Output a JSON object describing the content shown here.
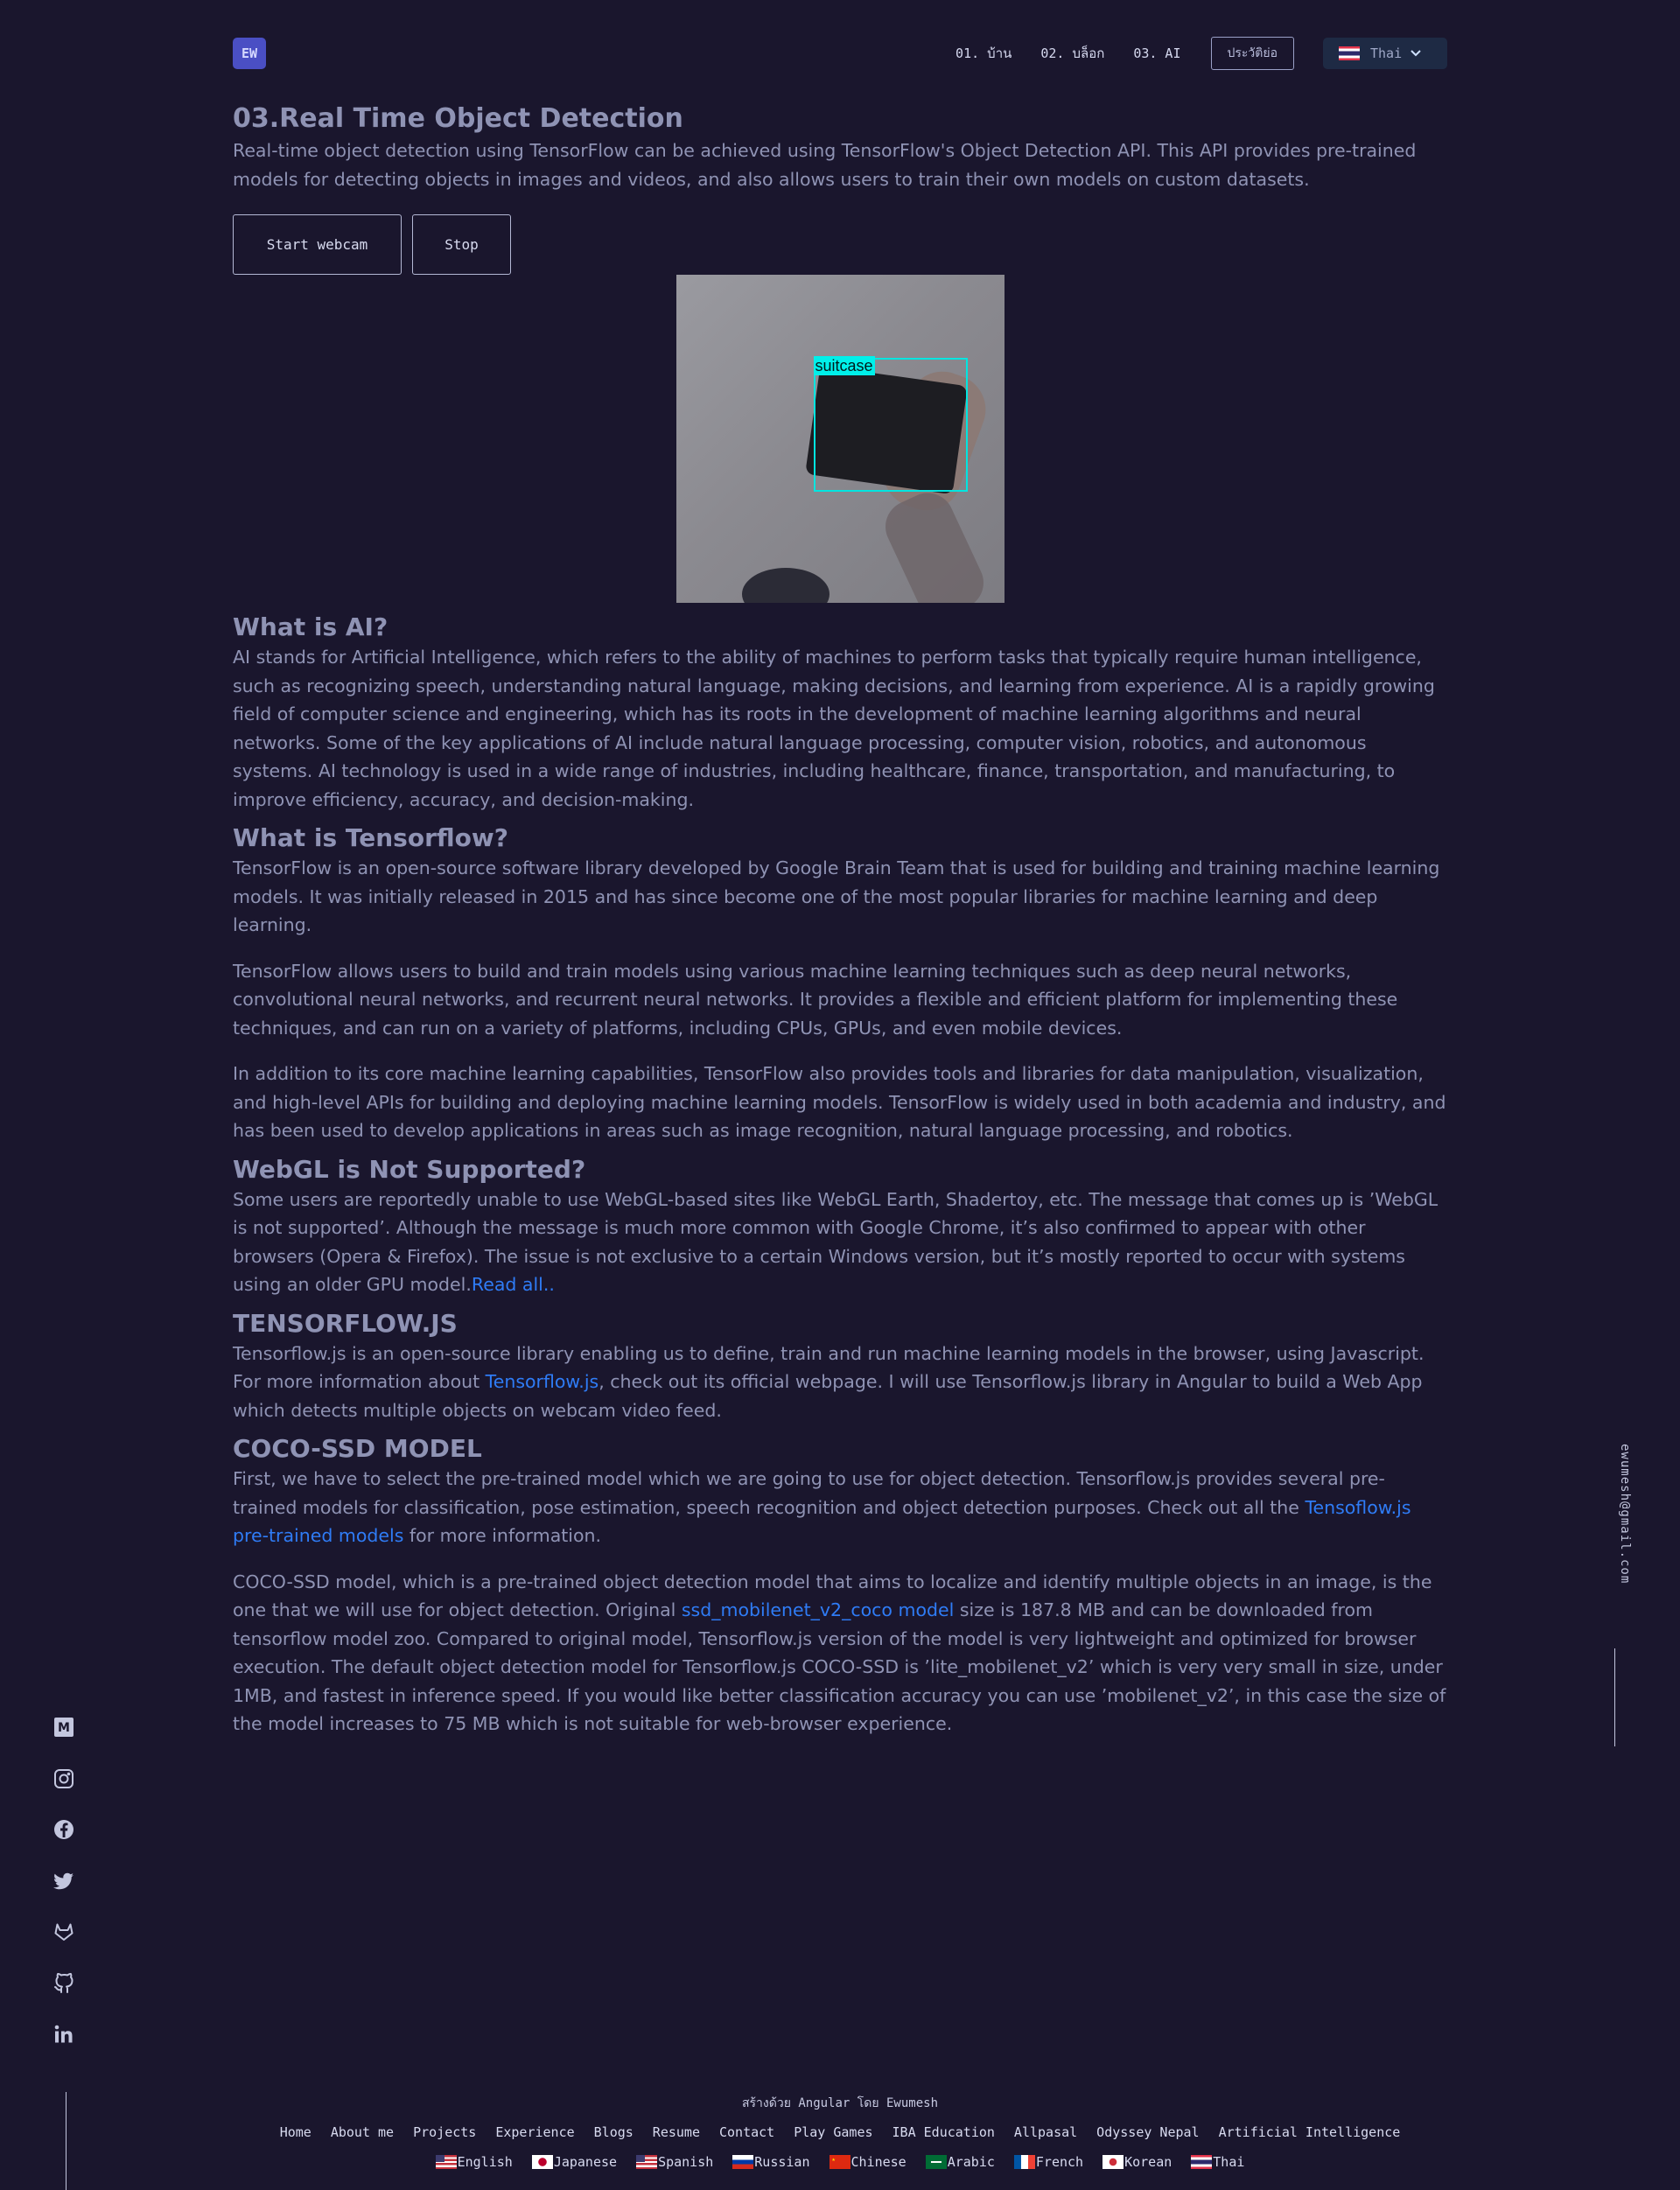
{
  "header": {
    "logo_text": "EW",
    "nav": [
      "01. บ้าน",
      "02. บล็อก",
      "03. AI"
    ],
    "resume_label": "ประวัติย่อ",
    "language_selected": "Thai",
    "language_flag": "thai-flag"
  },
  "main": {
    "title": "03.Real Time Object Detection",
    "intro": "Real-time object detection using TensorFlow can be achieved using TensorFlow's Object Detection API. This API provides pre-trained models for detecting objects in images and videos, and also allows users to train their own models on custom datasets.",
    "buttons": {
      "start": "Start webcam",
      "stop": "Stop"
    },
    "detection_label": "suitcase",
    "ai_heading": "What is AI?",
    "ai_text": "AI stands for Artificial Intelligence, which refers to the ability of machines to perform tasks that typically require human intelligence, such as recognizing speech, understanding natural language, making decisions, and learning from experience. AI is a rapidly growing field of computer science and engineering, which has its roots in the development of machine learning algorithms and neural networks. Some of the key applications of AI include natural language processing, computer vision, robotics, and autonomous systems. AI technology is used in a wide range of industries, including healthcare, finance, transportation, and manufacturing, to improve efficiency, accuracy, and decision-making.",
    "tf_heading": "What is Tensorflow?",
    "tf_p1": "TensorFlow is an open-source software library developed by Google Brain Team that is used for building and training machine learning models. It was initially released in 2015 and has since become one of the most popular libraries for machine learning and deep learning.",
    "tf_p2": "TensorFlow allows users to build and train models using various machine learning techniques such as deep neural networks, convolutional neural networks, and recurrent neural networks. It provides a flexible and efficient platform for implementing these techniques, and can run on a variety of platforms, including CPUs, GPUs, and even mobile devices.",
    "tf_p3": "In addition to its core machine learning capabilities, TensorFlow also provides tools and libraries for data manipulation, visualization, and high-level APIs for building and deploying machine learning models. TensorFlow is widely used in both academia and industry, and has been used to develop applications in areas such as image recognition, natural language processing, and robotics.",
    "webgl_heading": "WebGL is Not Supported?",
    "webgl_text": "Some users are reportedly unable to use WebGL-based sites like WebGL Earth, Shadertoy, etc. The message that comes up is ’WebGL is not supported’. Although the message is much more common with Google Chrome, it’s also confirmed to appear with other browsers (Opera & Firefox). The issue is not exclusive to a certain Windows version, but it’s mostly reported to occur with systems using an older GPU model.",
    "webgl_link": "Read all..",
    "tfjs_heading": "TENSORFLOW.JS",
    "tfjs_text_a": "Tensorflow.js is an open-source library enabling us to define, train and run machine learning models in the browser, using Javascript. For more information about ",
    "tfjs_link": "Tensorflow.js",
    "tfjs_text_b": ", check out its official webpage. I will use Tensorflow.js library in Angular to build a Web App which detects multiple objects on webcam video feed.",
    "coco_heading": "COCO-SSD MODEL",
    "coco_p1_a": "First, we have to select the pre-trained model which we are going to use for object detection. Tensorflow.js provides several pre-trained models for classification, pose estimation, speech recognition and object detection purposes. Check out all the ",
    "coco_p1_link": "Tensoflow.js pre-trained models",
    "coco_p1_b": " for more information.",
    "coco_p2_a": "COCO-SSD model, which is a pre-trained object detection model that aims to localize and identify multiple objects in an image, is the one that we will use for object detection. Original ",
    "coco_p2_link": "ssd_mobilenet_v2_coco model",
    "coco_p2_b": " size is 187.8 MB and can be downloaded from tensorflow model zoo. Compared to original model, Tensorflow.js version of the model is very lightweight and optimized for browser execution. The default object detection model for Tensorflow.js COCO-SSD is ’lite_mobilenet_v2’ which is very very small in size, under 1MB, and fastest in inference speed. If you would like better classification accuracy you can use ’mobilenet_v2’, in this case the size of the model increases to 75 MB which is not suitable for web-browser experience."
  },
  "social": [
    "medium-icon",
    "instagram-icon",
    "facebook-icon",
    "twitter-icon",
    "gitlab-icon",
    "github-icon",
    "linkedin-icon"
  ],
  "email": "ewumesh@gmail.com",
  "footer": {
    "built_by": "สร้างด้วย Angular โดย Ewumesh",
    "links": [
      "Home",
      "About me",
      "Projects",
      "Experience",
      "Blogs",
      "Resume",
      "Contact",
      "Play Games",
      "IBA Education",
      "Allpasal",
      "Odyssey Nepal",
      "Artificial Intelligence"
    ],
    "languages": [
      "English",
      "Japanese",
      "Spanish",
      "Russian",
      "Chinese",
      "Arabic",
      "French",
      "Korean",
      "Thai"
    ]
  },
  "colors": {
    "background": "#1a162d",
    "text": "#8f93b4",
    "link": "#2f7cf6",
    "detection_box": "#00e5e0"
  }
}
